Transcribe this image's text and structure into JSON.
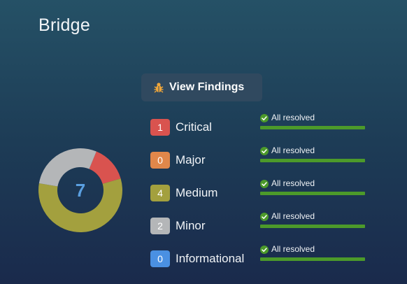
{
  "header": {
    "title": "Bridge"
  },
  "view_findings": {
    "label": "View Findings",
    "icon": "bug-icon"
  },
  "summary": {
    "total": "7",
    "colors": {
      "critical": "#d9534f",
      "major": "#e0874a",
      "medium": "#a3a03e",
      "minor": "#b4b6b8",
      "informational": "#4a90e2"
    }
  },
  "severities": [
    {
      "key": "critical",
      "label": "Critical",
      "count": 1,
      "count_label": "1",
      "color": "#d9534f",
      "status": "All resolved",
      "resolved_fraction": 1.0
    },
    {
      "key": "major",
      "label": "Major",
      "count": 0,
      "count_label": "0",
      "color": "#e0874a",
      "status": "All resolved",
      "resolved_fraction": 1.0
    },
    {
      "key": "medium",
      "label": "Medium",
      "count": 4,
      "count_label": "4",
      "color": "#a3a03e",
      "status": "All resolved",
      "resolved_fraction": 1.0
    },
    {
      "key": "minor",
      "label": "Minor",
      "count": 2,
      "count_label": "2",
      "color": "#b4b6b8",
      "status": "All resolved",
      "resolved_fraction": 1.0
    },
    {
      "key": "informational",
      "label": "Informational",
      "count": 0,
      "count_label": "0",
      "color": "#4a90e2",
      "status": "All resolved",
      "resolved_fraction": 1.0
    }
  ],
  "status_colors": {
    "resolved_check": "#4c9a2a",
    "progress_fill": "#4c9a2a"
  }
}
